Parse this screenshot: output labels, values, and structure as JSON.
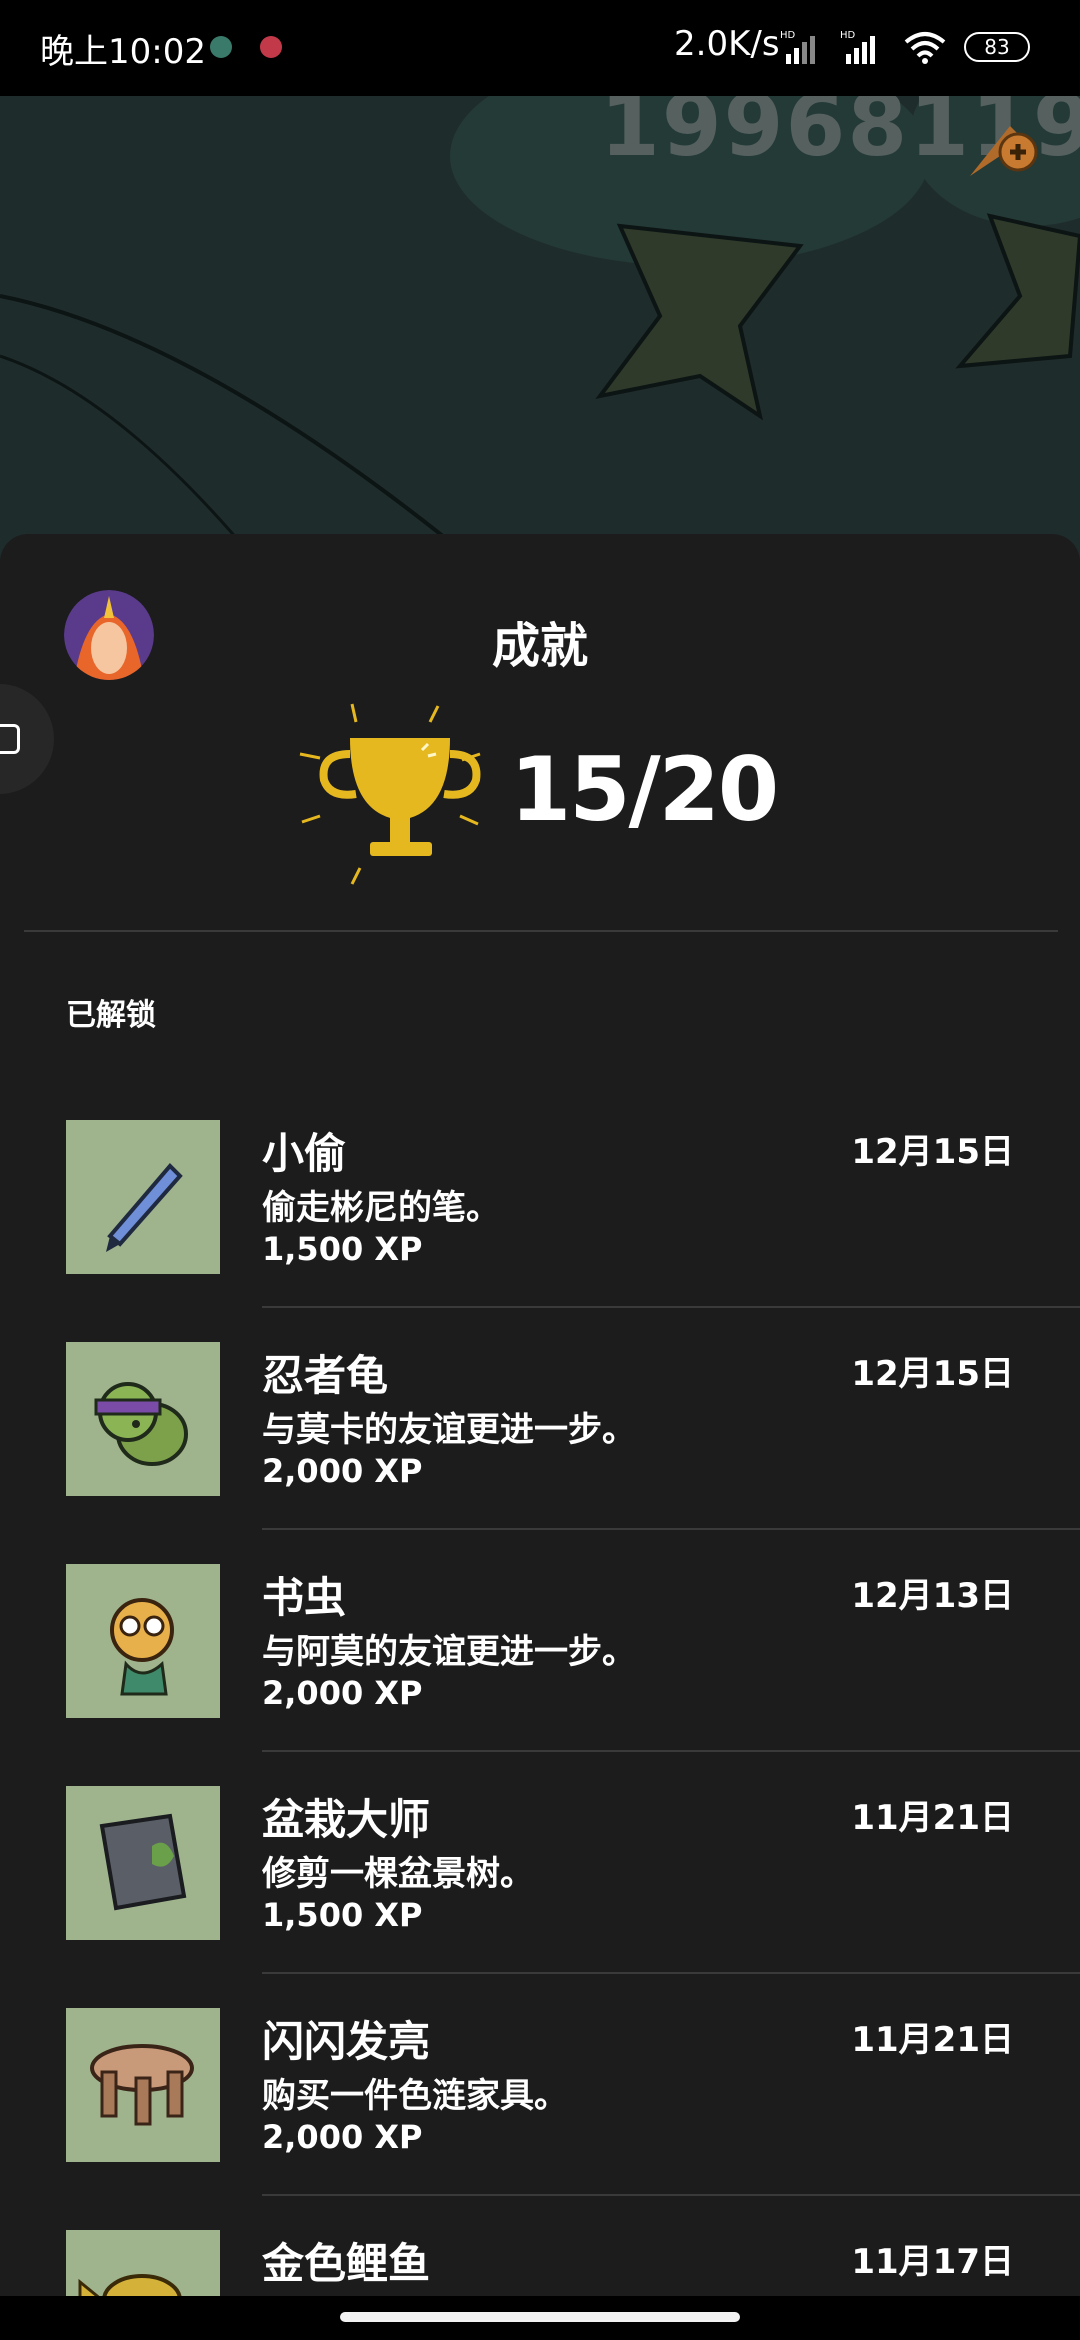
{
  "status_bar": {
    "time": "晚上10:02",
    "network_speed": "2.0K/s",
    "battery": "83"
  },
  "background": {
    "score": "19968119"
  },
  "sheet": {
    "title": "成就",
    "progress": "15/20",
    "section_label": "已解锁",
    "achievements": [
      {
        "name": "小偷",
        "description": "偷走彬尼的笔。",
        "xp": "1,500 XP",
        "date": "12月15日",
        "icon": "pen-icon"
      },
      {
        "name": "忍者龟",
        "description": "与莫卡的友谊更进一步。",
        "xp": "2,000 XP",
        "date": "12月15日",
        "icon": "ninja-turtle-icon"
      },
      {
        "name": "书虫",
        "description": "与阿莫的友谊更进一步。",
        "xp": "2,000 XP",
        "date": "12月13日",
        "icon": "giraffe-icon"
      },
      {
        "name": "盆栽大师",
        "description": "修剪一棵盆景树。",
        "xp": "1,500 XP",
        "date": "11月21日",
        "icon": "bonsai-book-icon"
      },
      {
        "name": "闪闪发亮",
        "description": "购买一件色涟家具。",
        "xp": "2,000 XP",
        "date": "11月21日",
        "icon": "stool-icon"
      },
      {
        "name": "金色鲤鱼",
        "description": "",
        "xp": "",
        "date": "11月17日",
        "icon": "goldfish-icon"
      }
    ]
  },
  "colors": {
    "sheet_bg": "#1c1c1d",
    "thumb_bg": "#9fb48d",
    "trophy": "#e6b820"
  }
}
